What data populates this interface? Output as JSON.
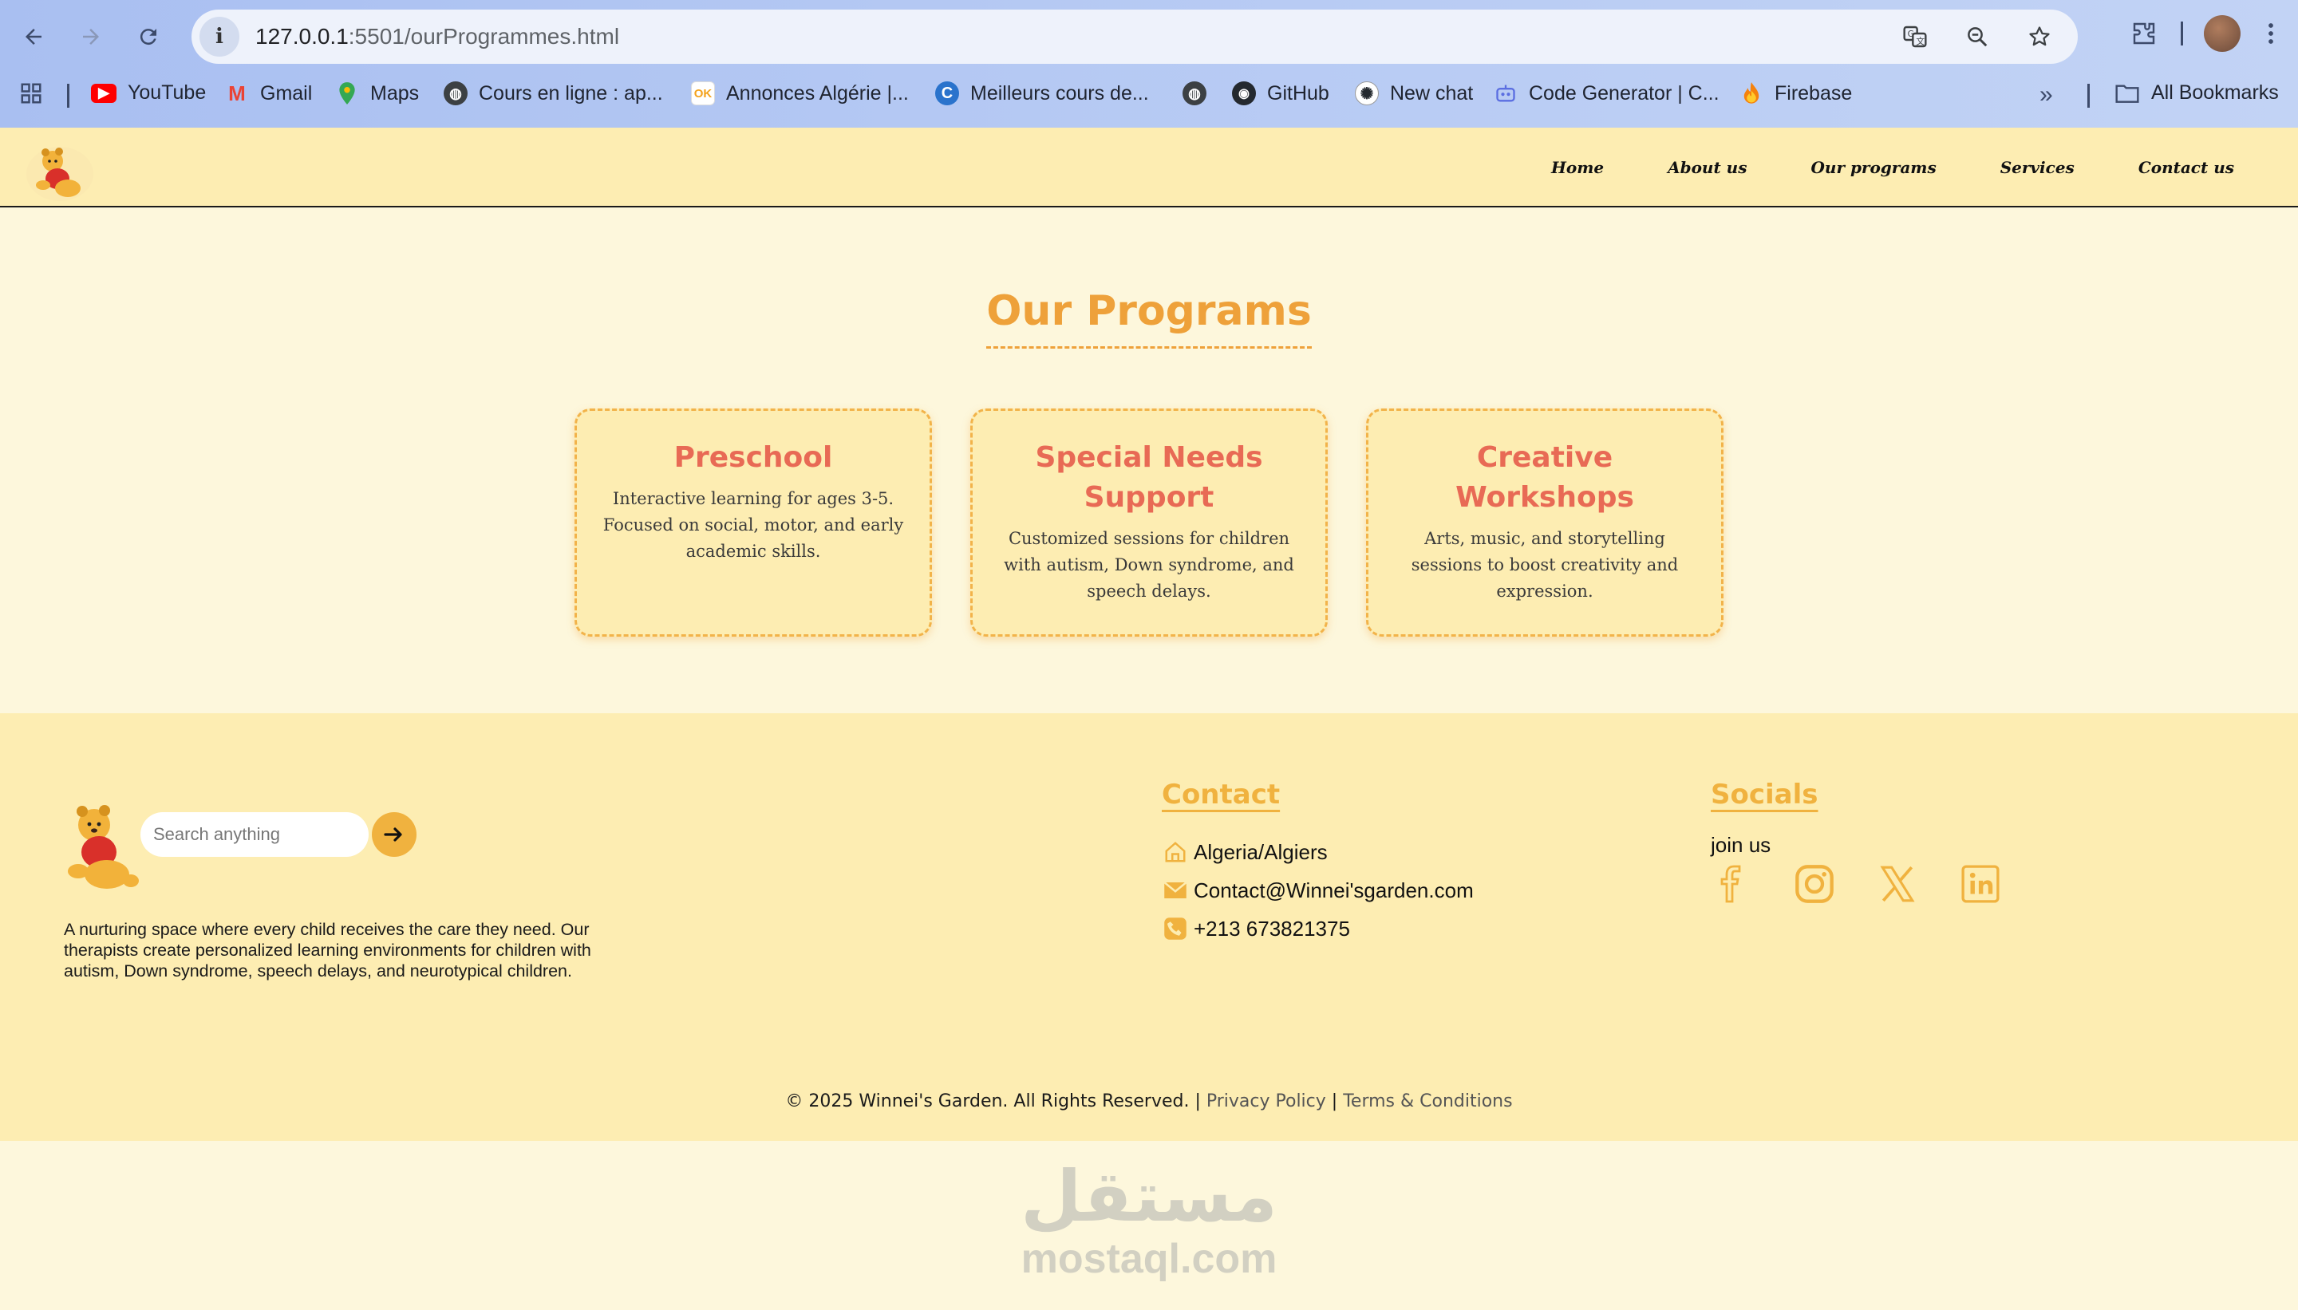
{
  "browser": {
    "url_host": "127.0.0.1",
    "url_rest": ":5501/ourProgrammes.html",
    "bookmarks": [
      {
        "label": "YouTube",
        "icon": "youtube-icon",
        "color": "#ff0000"
      },
      {
        "label": "Gmail",
        "icon": "gmail-icon",
        "color": "#ea4335"
      },
      {
        "label": "Maps",
        "icon": "maps-icon",
        "color": "#34a853"
      },
      {
        "label": "Cours en ligne  : ap...",
        "icon": "globe-icon",
        "color": "#3c4043"
      },
      {
        "label": "Annonces Algérie |...",
        "icon": "ok-icon",
        "color": "#f4a21c"
      },
      {
        "label": "Meilleurs cours de...",
        "icon": "coursera-icon",
        "color": "#2a73cc"
      },
      {
        "label": "",
        "icon": "globe-icon",
        "color": "#3c4043"
      },
      {
        "label": "GitHub",
        "icon": "github-icon",
        "color": "#24292f"
      },
      {
        "label": "New chat",
        "icon": "chatgpt-icon",
        "color": "#24292f"
      },
      {
        "label": "Code Generator | C...",
        "icon": "robot-icon",
        "color": "#5b6ee1"
      },
      {
        "label": "Firebase",
        "icon": "firebase-icon",
        "color": "#f5820d"
      }
    ],
    "all_bookmarks": "All Bookmarks"
  },
  "nav": {
    "items": [
      "Home",
      "About us",
      "Our programs",
      "Services",
      "Contact us"
    ]
  },
  "main": {
    "title": "Our Programs",
    "cards": [
      {
        "title": "Preschool",
        "text": "Interactive learning for ages 3-5. Focused on social, motor, and early academic skills."
      },
      {
        "title": "Special Needs Support",
        "text": "Customized sessions for children with autism, Down syndrome, and speech delays."
      },
      {
        "title": "Creative Workshops",
        "text": "Arts, music, and storytelling sessions to boost creativity and expression."
      }
    ]
  },
  "footer": {
    "search_placeholder": "Search anything",
    "description": "A nurturing space where every child receives the care they need. Our therapists create personalized learning environments for children with autism, Down syndrome, speech delays, and neurotypical children.",
    "contact_title": "Contact",
    "contact_items": [
      {
        "text": "Algeria/Algiers",
        "icon": "home-icon"
      },
      {
        "text": "Contact@Winnei'sgarden.com",
        "icon": "mail-icon"
      },
      {
        "text": "+213 673821375",
        "icon": "phone-icon"
      }
    ],
    "socials_title": "Socials",
    "join_text": "join us",
    "social_icons": [
      "facebook-icon",
      "instagram-icon",
      "x-icon",
      "linkedin-icon"
    ],
    "copyright": "© 2025 Winnei's Garden. All Rights Reserved. | ",
    "privacy": "Privacy Policy",
    "sep": " | ",
    "terms": "Terms & Conditions"
  },
  "watermark": {
    "arabic": "مستقل",
    "latin": "mostaql.com"
  },
  "colors": {
    "accent": "#eea13a",
    "card_title": "#e86a55",
    "header_bg": "#fdedb2",
    "page_bg": "#fdf7dc"
  }
}
